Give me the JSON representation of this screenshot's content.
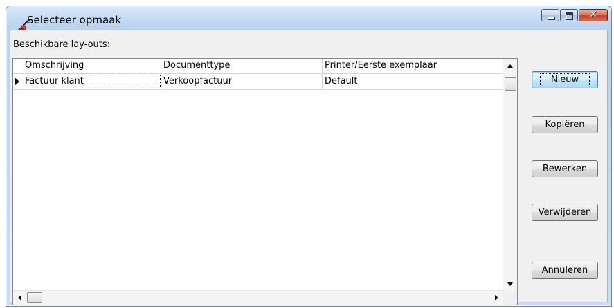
{
  "window": {
    "title": "Selecteer opmaak",
    "icon": "paint-brush-icon"
  },
  "caption_buttons": {
    "minimize_icon": "minimize-icon",
    "maximize_icon": "maximize-icon",
    "close_icon": "close-icon",
    "close_glyph": "✕"
  },
  "layouts": {
    "label": "Beschikbare lay-outs:",
    "columns": [
      "Omschrijving",
      "Documenttype",
      "Printer/Eerste exemplaar"
    ],
    "rows": [
      [
        "Factuur klant",
        "Verkoopfactuur",
        "Default"
      ]
    ]
  },
  "buttons": {
    "new": "Nieuw",
    "copy": "Kopiëren",
    "edit": "Bewerken",
    "delete": "Verwijderen",
    "cancel": "Annuleren"
  },
  "colors": {
    "title_bar": "#c6dbf3",
    "close_button": "#c4442b",
    "default_button": "#bee6fd"
  }
}
